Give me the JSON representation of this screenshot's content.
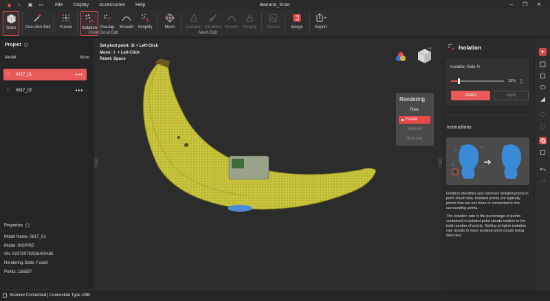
{
  "window": {
    "title": "Banana_Scan",
    "menu": [
      "File",
      "Display",
      "Accessories",
      "Help"
    ],
    "controls": [
      "–",
      "❐",
      "✕"
    ]
  },
  "toolbar": {
    "scan": "Scan",
    "one_click_edit": "One-click Edit",
    "fusion": "Fusion",
    "isolation": "Isolation",
    "overlap": "Overlap",
    "smooth": "Smooth",
    "simplify": "Simplify",
    "point_cloud_edit": "Point Cloud Edit",
    "mesh": "Mesh",
    "mesh_isolation": "Isolation",
    "fill_holes": "Fill Holes",
    "mesh_smooth": "Smooth",
    "mesh_simplify": "Simplify",
    "mesh_edit": "Mesh Edit",
    "texture": "Texture",
    "merge": "Merge",
    "export": "Export"
  },
  "project": {
    "title": "Project",
    "model_label": "Model",
    "more_label": "More",
    "models": [
      {
        "name": "0817_01",
        "selected": true
      },
      {
        "name": "0817_02",
        "selected": false
      }
    ]
  },
  "properties": {
    "title": "Properties",
    "rows": [
      {
        "label": "Model Name:",
        "value": "0817_01"
      },
      {
        "label": "Model:",
        "value": "INSPIRE"
      },
      {
        "label": "SN:",
        "value": "A23700792C6H00A95"
      },
      {
        "label": "Rendering State:",
        "value": "Fused"
      },
      {
        "label": "Points:",
        "value": "166597"
      }
    ]
  },
  "viewport": {
    "hints": [
      "Set pivot point: ⌘ + Left-Click",
      "Move: ⇧ + Left-Click",
      "Reset: Space"
    ],
    "rendering": {
      "title": "Rendering",
      "options": [
        {
          "label": "Raw",
          "state": "normal"
        },
        {
          "label": "Fused",
          "state": "selected"
        },
        {
          "label": "Meshed",
          "state": "disabled"
        },
        {
          "label": "Textured",
          "state": "disabled"
        }
      ]
    }
  },
  "isolation_panel": {
    "title": "Isolation",
    "rate_label": "Isolation Rate",
    "rate_value": 15,
    "rate_display": "15%",
    "detect": "Detect",
    "apply": "Apply",
    "instructions_title": "Instructions",
    "paragraphs": [
      "Isolation identifies and removes isolated points in point cloud data. Isolated points are typically points that are not close or connected to the surrounding points.",
      "The isolation rate is the percentage of points contained in isolated point clouds relative to the total number of points. Setting a higher isolation rate results in more isolated point clouds being detected."
    ]
  },
  "status": {
    "text": "Scanner Connected | Connection Type USB"
  },
  "colors": {
    "accent": "#e84a4a",
    "banana": "#c9c437",
    "panel": "#2a2a2a"
  }
}
